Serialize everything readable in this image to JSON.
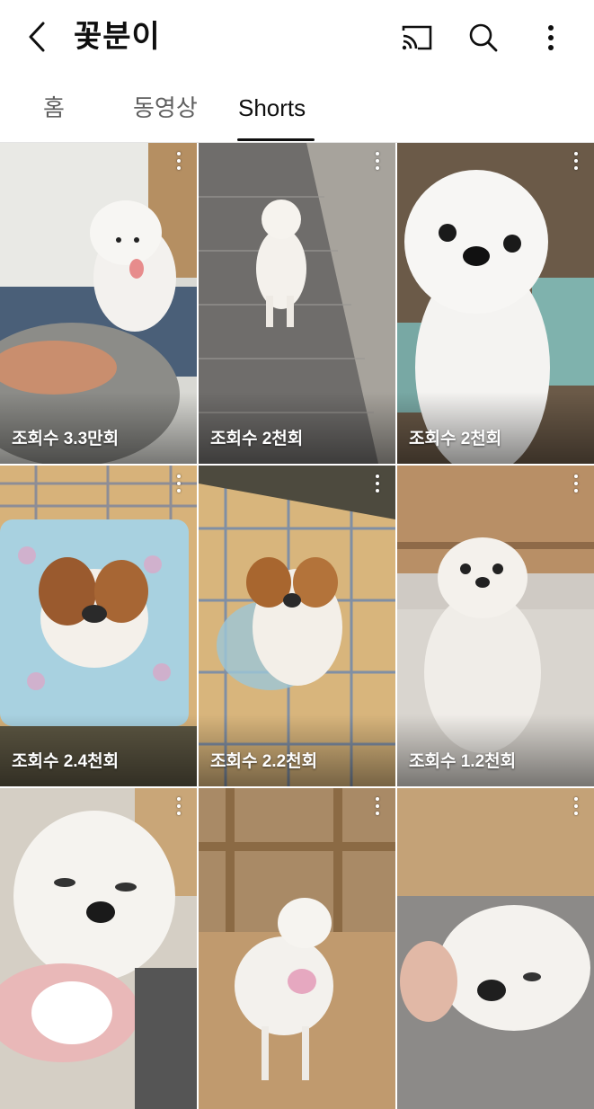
{
  "header": {
    "title": "꽃분이",
    "back_icon": "chevron-left-icon",
    "cast_icon": "cast-icon",
    "search_icon": "search-icon",
    "more_icon": "more-vertical-icon"
  },
  "tabs": [
    {
      "label": "홈",
      "active": false
    },
    {
      "label": "동영상",
      "active": false
    },
    {
      "label": "Shorts",
      "active": true
    }
  ],
  "shorts": [
    {
      "views": "조회수 3.3만회"
    },
    {
      "views": "조회수 2천회"
    },
    {
      "views": "조회수 2천회"
    },
    {
      "views": "조회수 2.4천회"
    },
    {
      "views": "조회수 2.2천회"
    },
    {
      "views": "조회수 1.2천회"
    },
    {
      "views": ""
    },
    {
      "views": ""
    },
    {
      "views": ""
    }
  ]
}
